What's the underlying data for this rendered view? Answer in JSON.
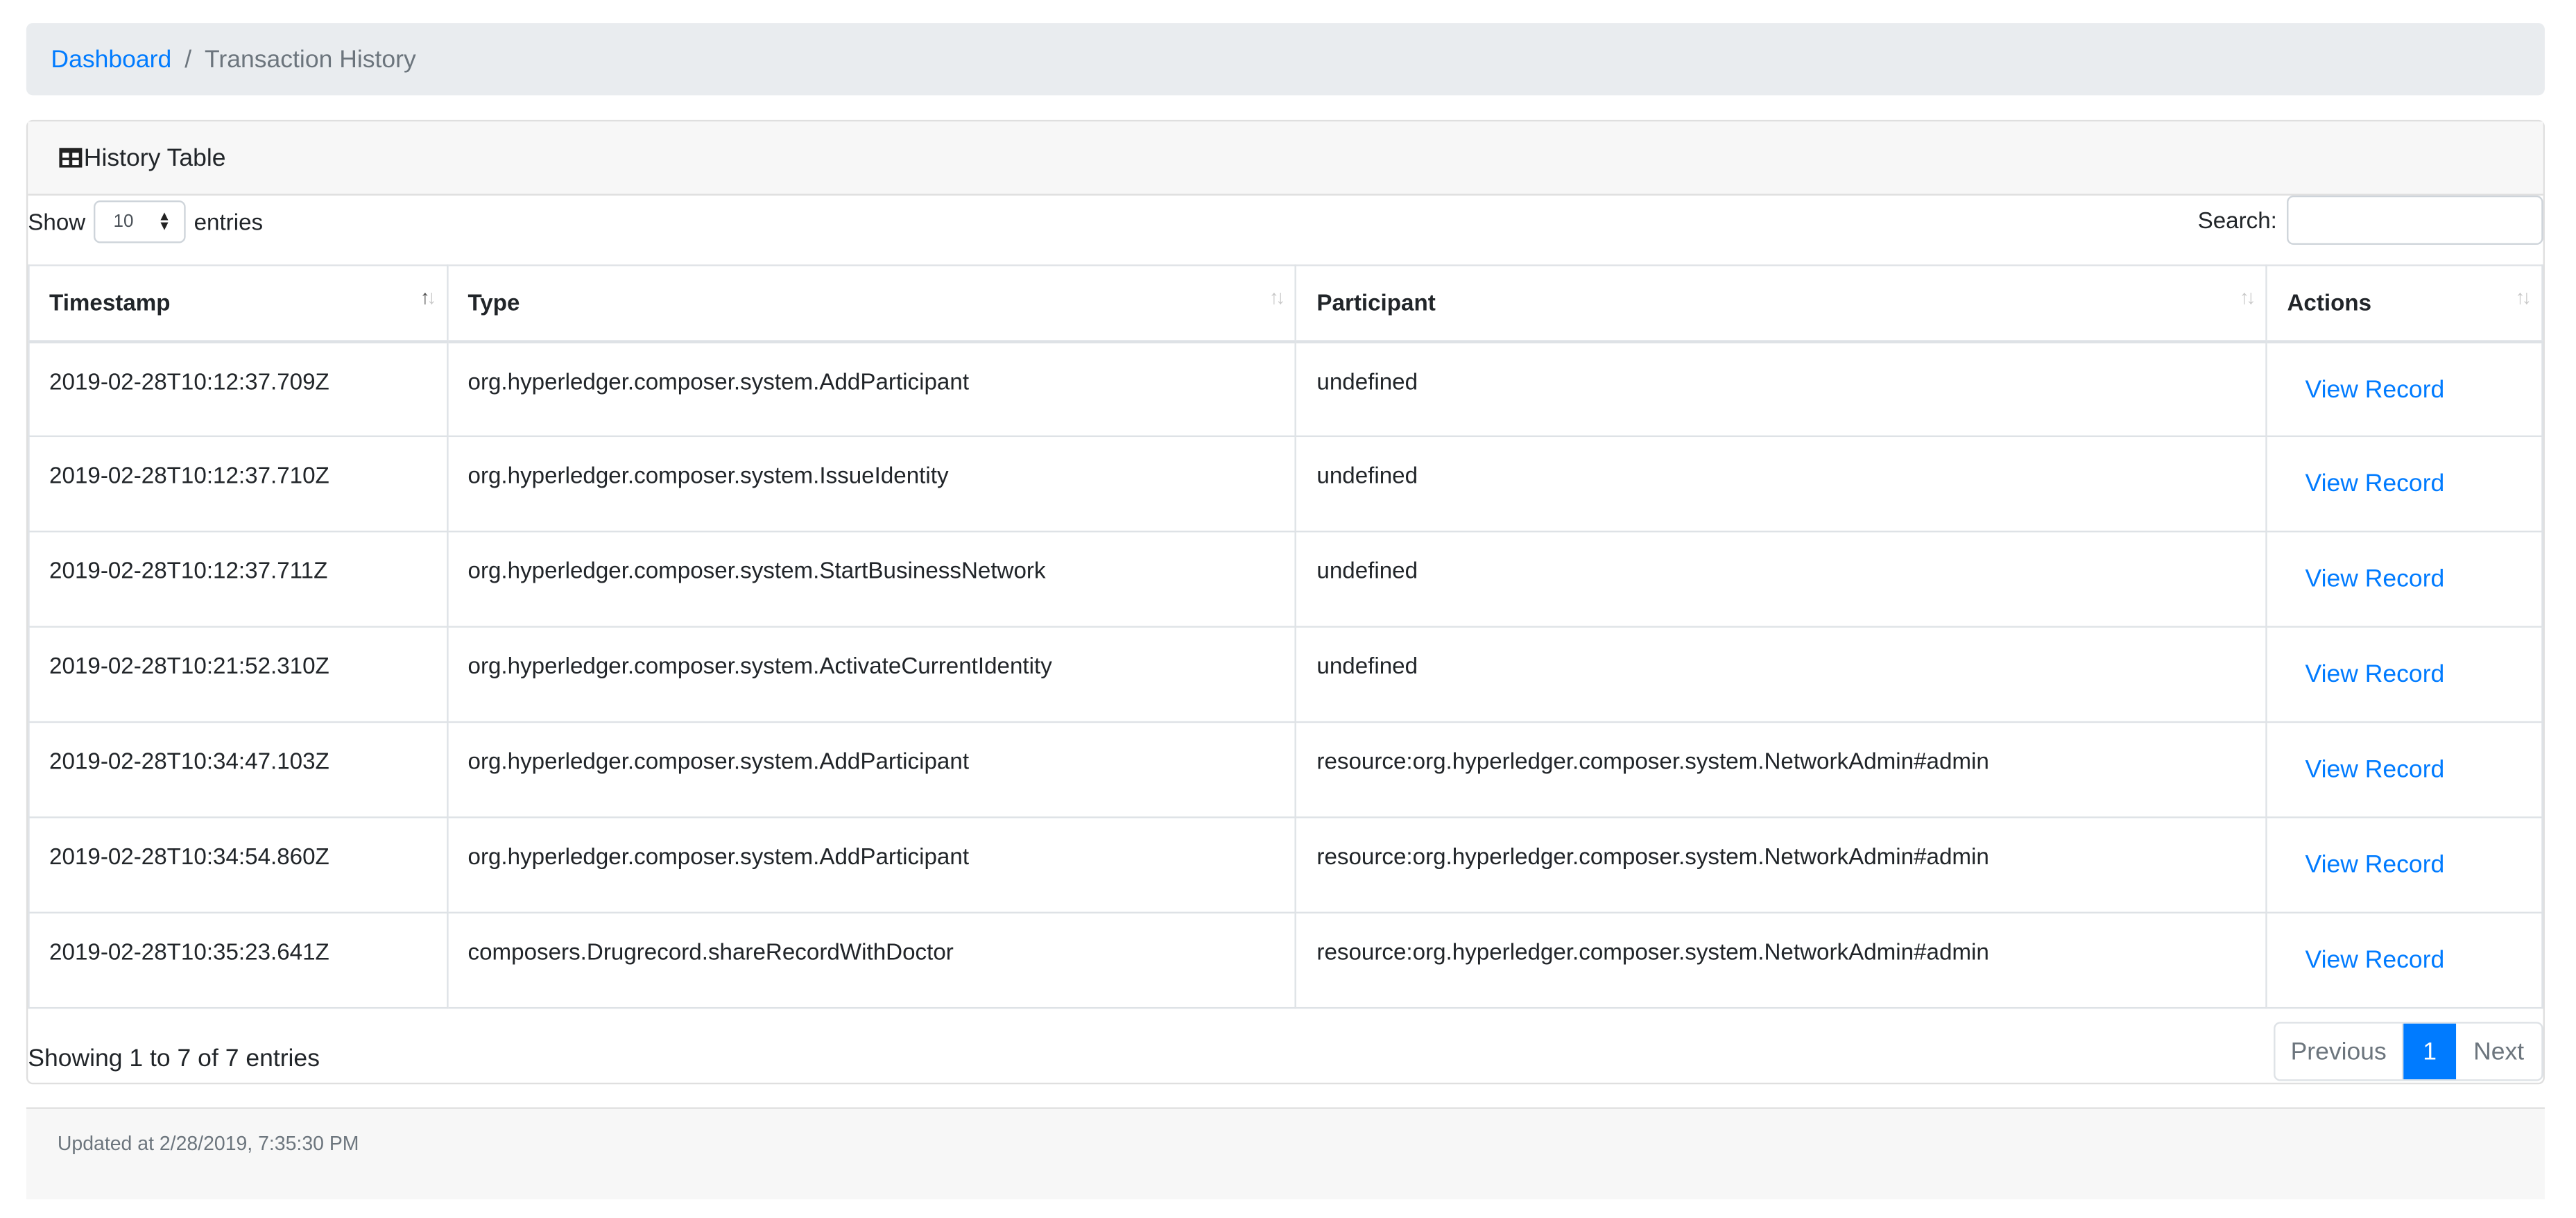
{
  "breadcrumb": {
    "home": "Dashboard",
    "separator": "/",
    "current": "Transaction History"
  },
  "card": {
    "title": "History Table",
    "icon": "table-icon"
  },
  "controls": {
    "show_label": "Show",
    "page_size": "10",
    "entries_label": "entries",
    "search_label": "Search:",
    "search_value": ""
  },
  "table": {
    "columns": [
      "Timestamp",
      "Type",
      "Participant",
      "Actions"
    ],
    "rows": [
      {
        "timestamp": "2019-02-28T10:12:37.709Z",
        "type": "org.hyperledger.composer.system.AddParticipant",
        "participant": "undefined",
        "action": "View Record"
      },
      {
        "timestamp": "2019-02-28T10:12:37.710Z",
        "type": "org.hyperledger.composer.system.IssueIdentity",
        "participant": "undefined",
        "action": "View Record"
      },
      {
        "timestamp": "2019-02-28T10:12:37.711Z",
        "type": "org.hyperledger.composer.system.StartBusinessNetwork",
        "participant": "undefined",
        "action": "View Record"
      },
      {
        "timestamp": "2019-02-28T10:21:52.310Z",
        "type": "org.hyperledger.composer.system.ActivateCurrentIdentity",
        "participant": "undefined",
        "action": "View Record"
      },
      {
        "timestamp": "2019-02-28T10:34:47.103Z",
        "type": "org.hyperledger.composer.system.AddParticipant",
        "participant": "resource:org.hyperledger.composer.system.NetworkAdmin#admin",
        "action": "View Record"
      },
      {
        "timestamp": "2019-02-28T10:34:54.860Z",
        "type": "org.hyperledger.composer.system.AddParticipant",
        "participant": "resource:org.hyperledger.composer.system.NetworkAdmin#admin",
        "action": "View Record"
      },
      {
        "timestamp": "2019-02-28T10:35:23.641Z",
        "type": "composers.Drugrecord.shareRecordWithDoctor",
        "participant": "resource:org.hyperledger.composer.system.NetworkAdmin#admin",
        "action": "View Record"
      }
    ]
  },
  "footer_info": "Showing 1 to 7 of 7 entries",
  "pagination": {
    "previous": "Previous",
    "current": "1",
    "next": "Next"
  },
  "updated": "Updated at 2/28/2019, 7:35:30 PM",
  "colors": {
    "link": "#007bff",
    "breadcrumb_bg": "#e9ecef",
    "header_bg": "#f7f7f7"
  }
}
